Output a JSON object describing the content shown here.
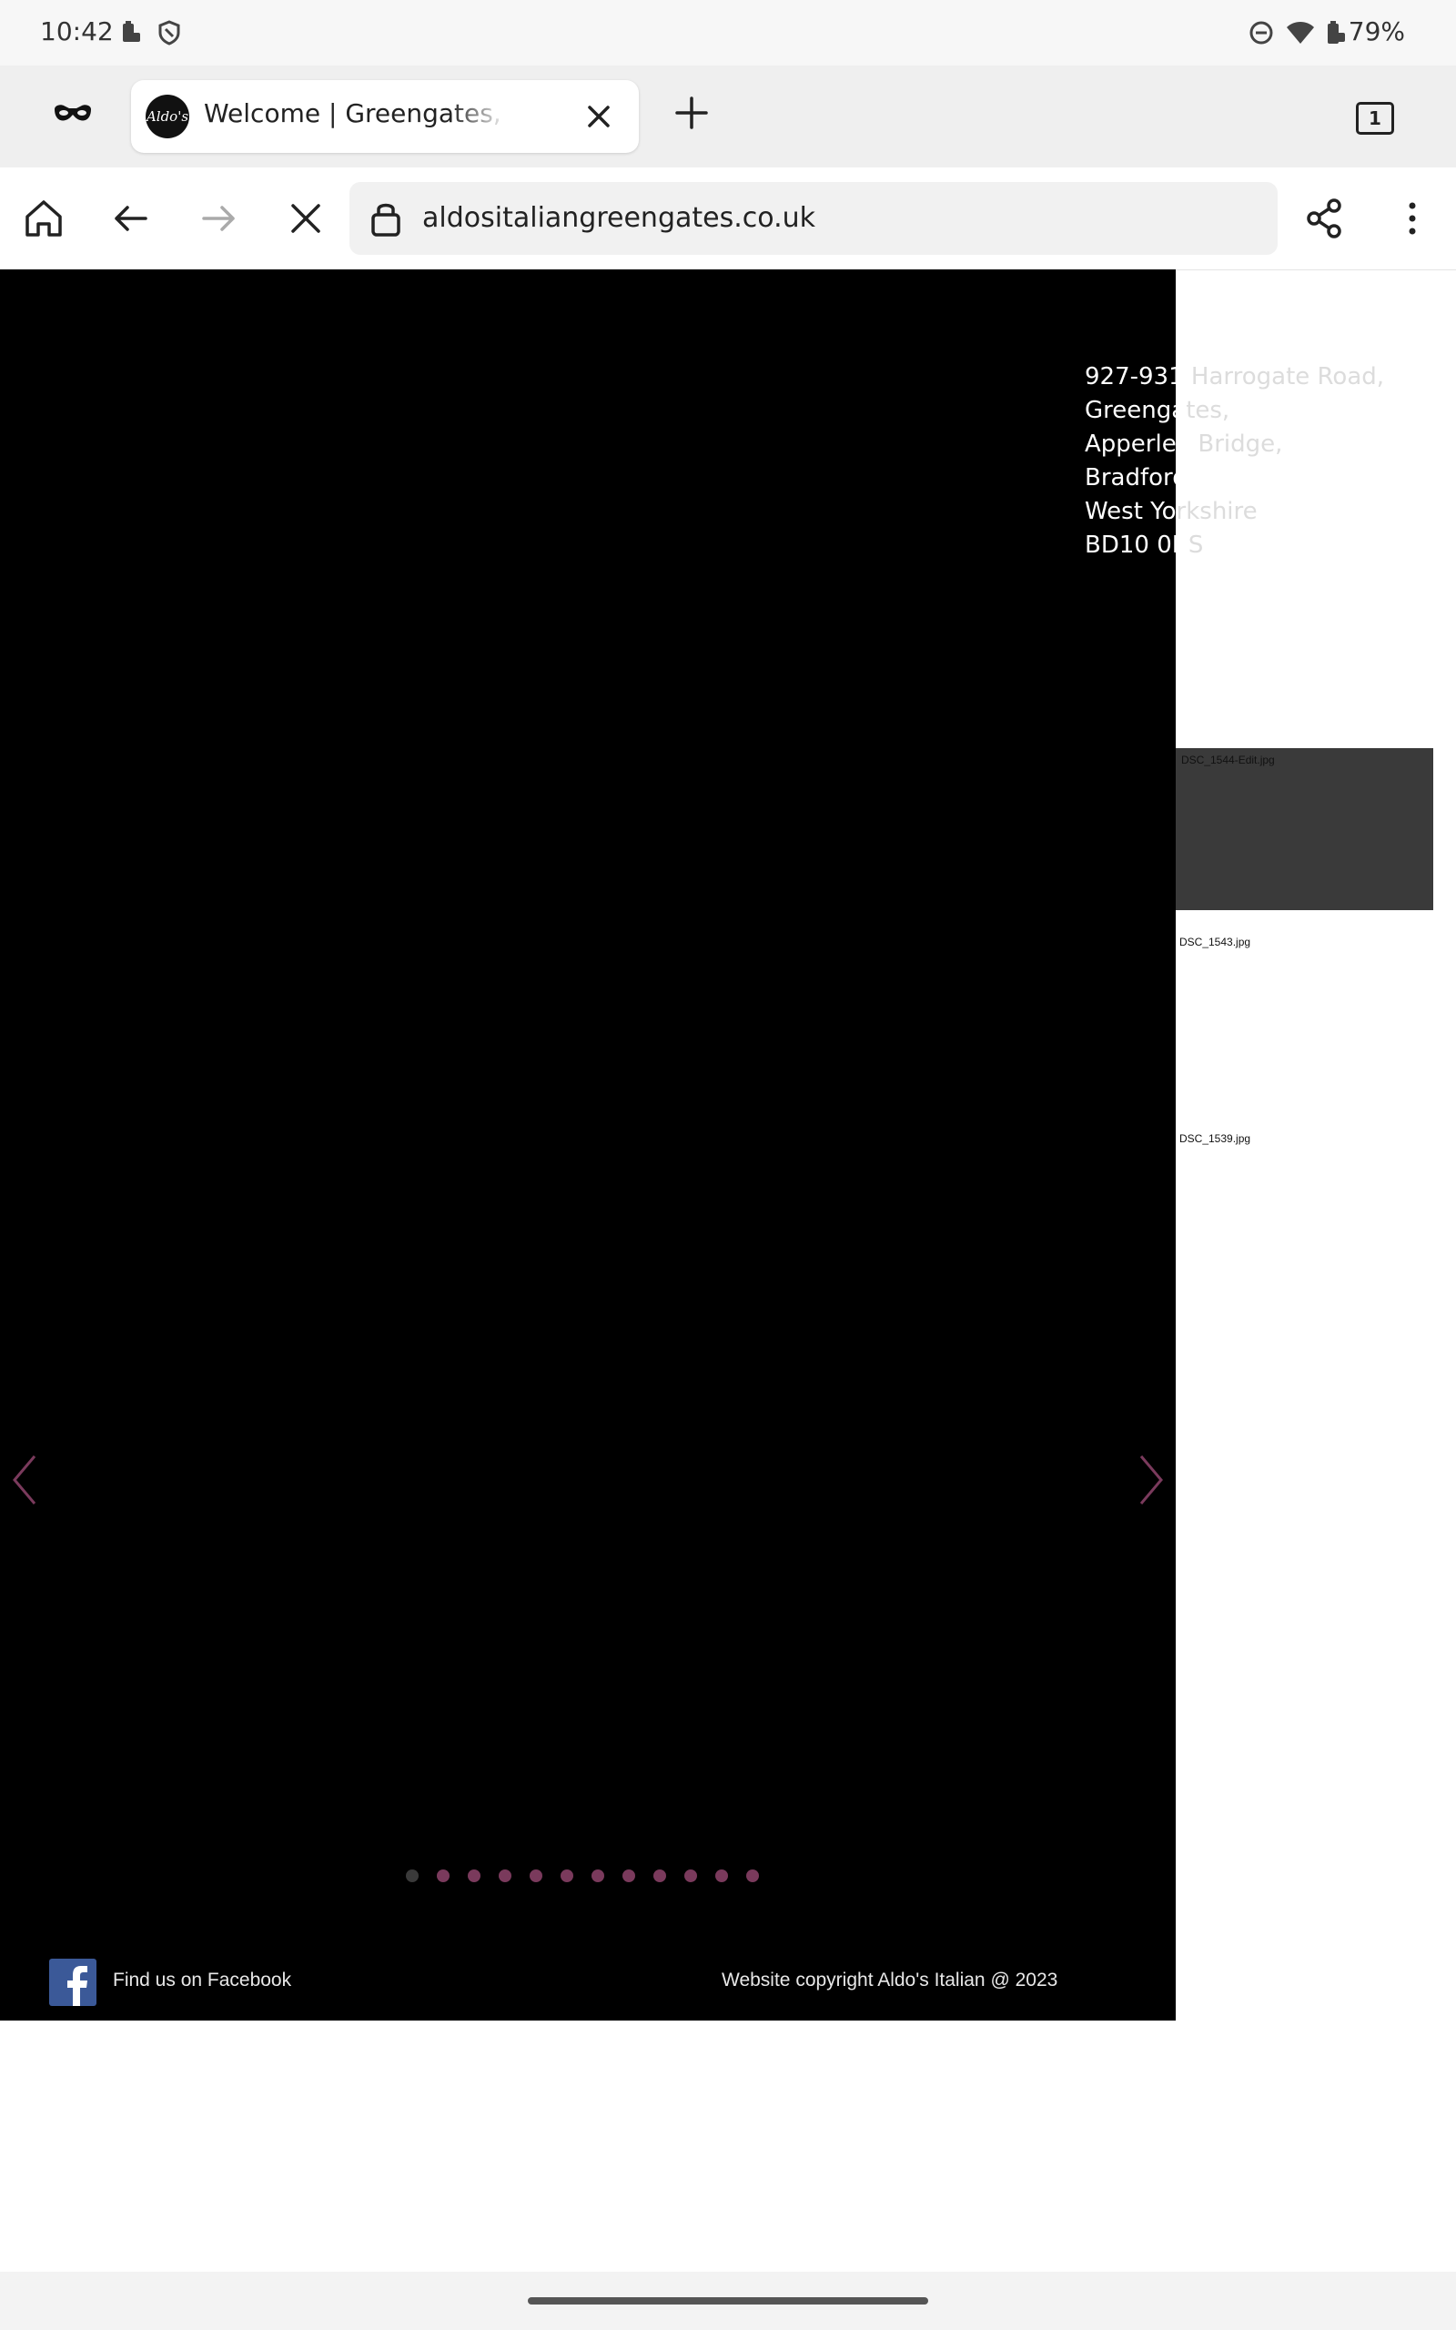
{
  "status_bar": {
    "time": "10:42",
    "battery": "79%",
    "icons": [
      "battery-saver-icon",
      "shield-icon",
      "do-not-disturb-icon",
      "wifi-icon",
      "battery-icon"
    ]
  },
  "tabs": {
    "active_title": "Welcome | Greengates, Bradford",
    "favicon_text": "Aldo's",
    "count": "1"
  },
  "toolbar": {
    "url": "aldositaliangreengates.co.uk"
  },
  "page": {
    "address_lines": [
      {
        "shown": "927-931",
        "faded": " Harrogate Road,"
      },
      {
        "shown": "Greenga",
        "faded": "tes,"
      },
      {
        "shown": "Apperley",
        "faded": " Bridge,"
      },
      {
        "shown": "Bradford",
        "faded": ""
      },
      {
        "shown": "West Yo",
        "faded": "rkshire"
      },
      {
        "shown": "BD10 0R",
        "faded": "S"
      }
    ],
    "thumbnails": [
      "DSC_1544-Edit.jpg",
      "DSC_1543.jpg",
      "DSC_1539.jpg"
    ],
    "slide_count": 12,
    "active_slide": 1,
    "facebook_label": "Find us on Facebook",
    "copyright": "Website copyright Aldo's Italian @ 2023",
    "colors": {
      "dot": "#7a3a5c",
      "dot_active": "#3a3a3a",
      "facebook": "#3b5998",
      "arrow": "#7a3a5c"
    }
  }
}
